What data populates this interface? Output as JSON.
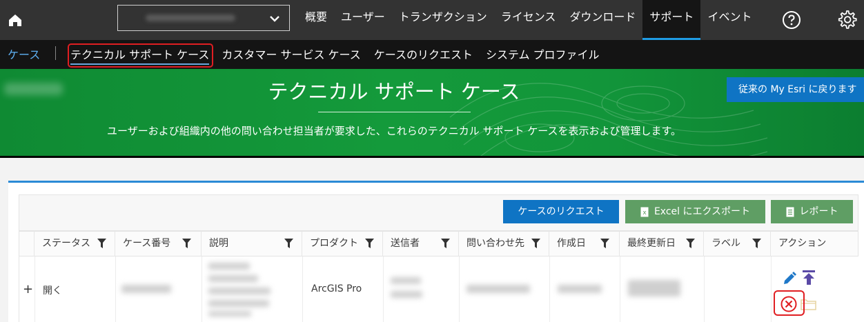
{
  "topnav": {
    "items": [
      "概要",
      "ユーザー",
      "トランザクション",
      "ライセンス",
      "ダウンロード",
      "サポート",
      "イベント"
    ],
    "active": "サポート"
  },
  "subnav": {
    "cases_label": "ケース",
    "links": [
      "テクニカル サポート ケース",
      "カスタマー サービス ケース",
      "ケースのリクエスト",
      "システム プロファイル"
    ]
  },
  "hero": {
    "title": "テクニカル サポート ケース",
    "description": "ユーザーおよび組織内の他の問い合わせ担当者が要求した、これらのテクニカル サポート ケースを表示および管理します。",
    "legacy_button": "従来の My Esri に戻ります"
  },
  "toolbar": {
    "request_button": "ケースのリクエスト",
    "excel_button": "Excel にエクスポート",
    "report_button": "レポート"
  },
  "table": {
    "headers": [
      "ステータス",
      "ケース番号",
      "説明",
      "プロダクト",
      "送信者",
      "問い合わせ先",
      "作成日",
      "最終更新日",
      "ラベル",
      "アクション"
    ],
    "row": {
      "expand": "+",
      "status": "開く",
      "product": "ArcGIS Pro"
    }
  },
  "colors": {
    "topnav": "#333333",
    "subnav": "#141414",
    "accent_blue": "#0f74c4",
    "hero_green": "#149a3b",
    "button_green": "#5f9e64",
    "highlight_red": "#e01e22"
  }
}
